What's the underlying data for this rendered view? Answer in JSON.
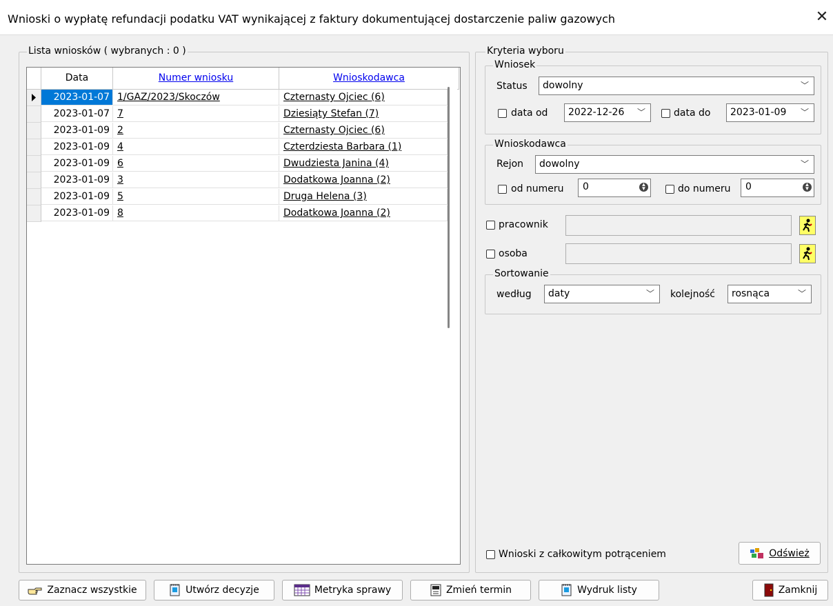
{
  "window": {
    "title": "Wnioski o wypłatę refundacji podatku VAT wynikającej z faktury dokumentującej dostarczenie paliw gazowych",
    "close": "✕"
  },
  "list": {
    "legend": "Lista wniosków ( wybranych : 0 )",
    "columns": [
      "Data",
      "Numer wniosku",
      "Wnioskodawca"
    ],
    "rows": [
      {
        "date": "2023-01-07",
        "number": "1/GAZ/2023/Skoczów",
        "applicant": "Czternasty Ojciec (6)"
      },
      {
        "date": "2023-01-07",
        "number": "7",
        "applicant": "Dziesiąty Stefan (7)"
      },
      {
        "date": "2023-01-09",
        "number": "2",
        "applicant": "Czternasty Ojciec (6)"
      },
      {
        "date": "2023-01-09",
        "number": "4",
        "applicant": "Czterdziesta Barbara (1)"
      },
      {
        "date": "2023-01-09",
        "number": "6",
        "applicant": "Dwudziesta Janina (4)"
      },
      {
        "date": "2023-01-09",
        "number": "3",
        "applicant": "Dodatkowa Joanna (2)"
      },
      {
        "date": "2023-01-09",
        "number": "5",
        "applicant": "Druga Helena (3)"
      },
      {
        "date": "2023-01-09",
        "number": "8",
        "applicant": "Dodatkowa Joanna (2)"
      }
    ]
  },
  "criteria": {
    "legend": "Kryteria wyboru",
    "request": {
      "legend": "Wniosek",
      "status_label": "Status",
      "status_value": "dowolny",
      "date_from_label": "data od",
      "date_from_value": "2022-12-26",
      "date_to_label": "data do",
      "date_to_value": "2023-01-09"
    },
    "applicant": {
      "legend": "Wnioskodawca",
      "region_label": "Rejon",
      "region_value": "dowolny",
      "from_number_label": "od numeru",
      "from_number_value": "0",
      "to_number_label": "do numeru",
      "to_number_value": "0"
    },
    "employee_label": "pracownik",
    "person_label": "osoba",
    "sorting": {
      "legend": "Sortowanie",
      "by_label": "według",
      "by_value": "daty",
      "order_label": "kolejność",
      "order_value": "rosnąca"
    },
    "full_deduction_label": "Wnioski z całkowitym potrąceniem",
    "refresh_label": "Odśwież"
  },
  "buttons": {
    "select_all": "Zaznacz wszystkie",
    "create_decision": "Utwórz decyzje",
    "case_record": "Metryka sprawy",
    "change_deadline": "Zmień termin",
    "print_list": "Wydruk listy",
    "close": "Zamknij"
  },
  "icons": [
    "hand-point-icon",
    "document-icon",
    "calendar-icon",
    "clock-icon",
    "printer-icon",
    "door-icon",
    "refresh-icon",
    "runner-icon"
  ]
}
